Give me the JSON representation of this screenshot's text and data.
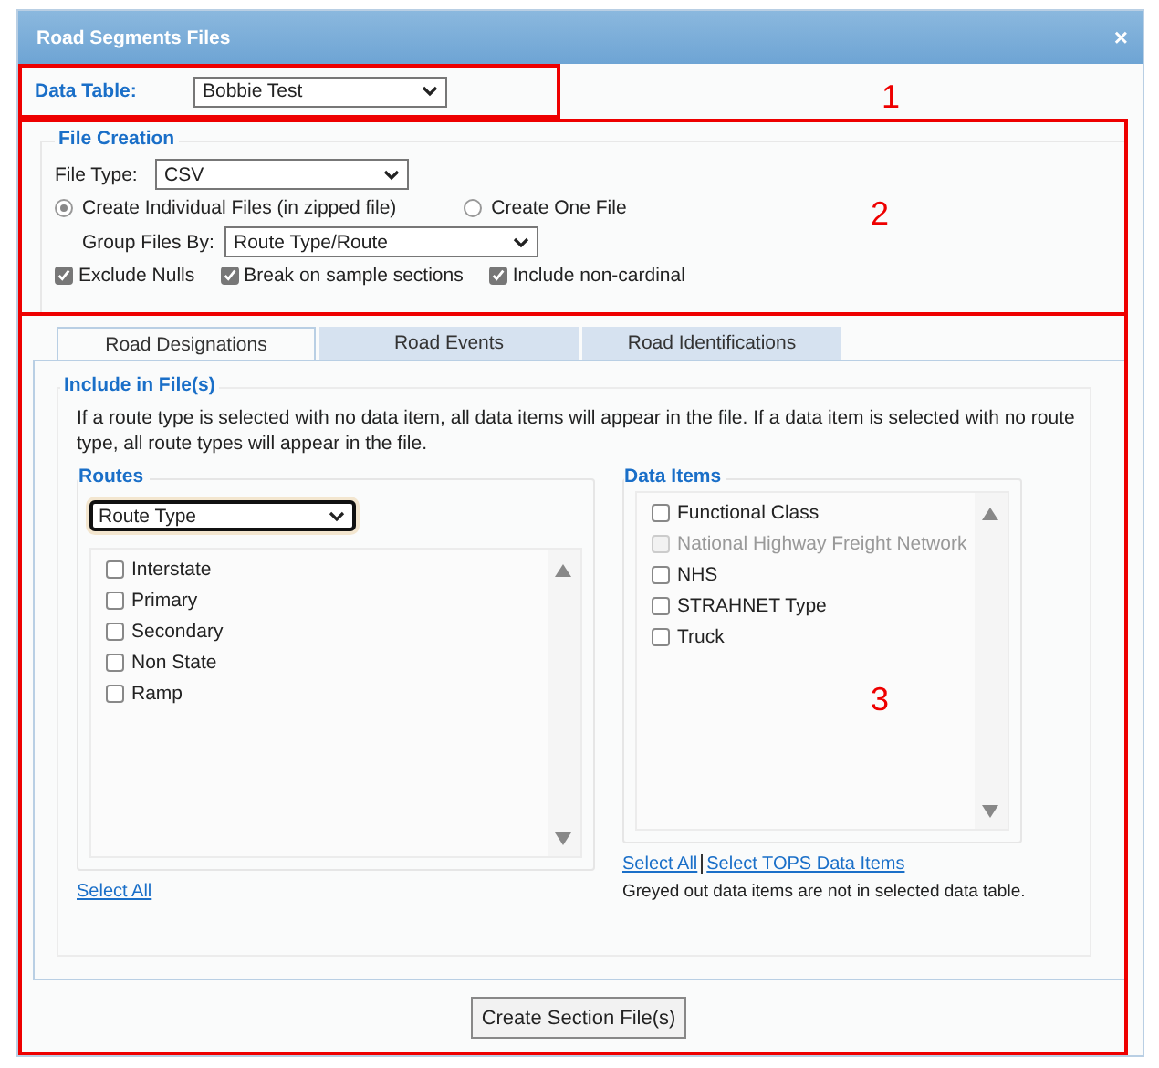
{
  "window": {
    "title": "Road Segments Files",
    "close": "×"
  },
  "data_table": {
    "label": "Data Table:",
    "value": "Bobbie Test",
    "annotation": "1"
  },
  "file_creation": {
    "title": "File Creation",
    "annotation": "2",
    "file_type": {
      "label": "File Type:",
      "value": "CSV"
    },
    "modes": [
      {
        "label": "Create Individual Files (in zipped file)",
        "selected": true
      },
      {
        "label": "Create One File",
        "selected": false
      }
    ],
    "group_by": {
      "label": "Group Files By:",
      "value": "Route Type/Route"
    },
    "options": [
      {
        "label": "Exclude Nulls",
        "checked": true
      },
      {
        "label": "Break on sample sections",
        "checked": true
      },
      {
        "label": "Include non-cardinal",
        "checked": true
      }
    ]
  },
  "tabs": [
    {
      "label": "Road Designations",
      "selected": true
    },
    {
      "label": "Road Events",
      "selected": false
    },
    {
      "label": "Road Identifications",
      "selected": false
    }
  ],
  "include": {
    "title": "Include in File(s)",
    "annotation": "3",
    "note": "If a route type is selected with no data item, all data items will appear in the file. If a data item is selected with no route type, all route types will appear in the file.",
    "routes": {
      "title": "Routes",
      "filter": "Route Type",
      "items": [
        {
          "label": "Interstate",
          "checked": false,
          "disabled": false
        },
        {
          "label": "Primary",
          "checked": false,
          "disabled": false
        },
        {
          "label": "Secondary",
          "checked": false,
          "disabled": false
        },
        {
          "label": "Non State",
          "checked": false,
          "disabled": false
        },
        {
          "label": "Ramp",
          "checked": false,
          "disabled": false
        }
      ],
      "links": [
        "Select All"
      ]
    },
    "data_items": {
      "title": "Data Items",
      "items": [
        {
          "label": "Functional Class",
          "checked": false,
          "disabled": false
        },
        {
          "label": "National Highway Freight Network",
          "checked": false,
          "disabled": true
        },
        {
          "label": "NHS",
          "checked": false,
          "disabled": false
        },
        {
          "label": "STRAHNET Type",
          "checked": false,
          "disabled": false
        },
        {
          "label": "Truck",
          "checked": false,
          "disabled": false
        }
      ],
      "links": [
        "Select All",
        "Select TOPS Data Items"
      ],
      "note": "Greyed out data items are not in selected data table."
    }
  },
  "button": "Create Section File(s)"
}
